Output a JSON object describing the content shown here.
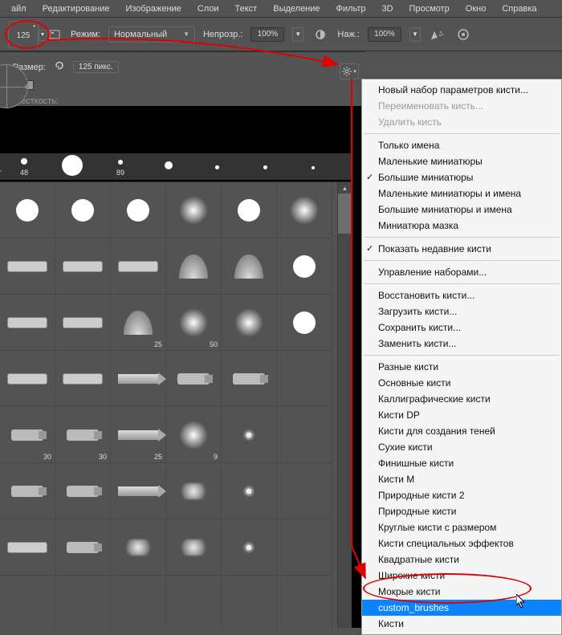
{
  "menubar": [
    "айл",
    "Редактирование",
    "Изображение",
    "Слои",
    "Текст",
    "Выделение",
    "Фильтр",
    "3D",
    "Просмотр",
    "Окно",
    "Справка"
  ],
  "options": {
    "brush_size": "125",
    "mode_label": "Режим:",
    "mode_value": "Нормальный",
    "opacity_label": "Непрозр.:",
    "opacity_value": "100%",
    "flow_label": "Наж.:",
    "flow_value": "100%"
  },
  "preset_panel": {
    "size_label": "Размер:",
    "size_value": "125 пикс.",
    "hardness_label": "Жесткость:"
  },
  "brush_strip": [
    {
      "num": "48",
      "r": 5
    },
    {
      "num": "",
      "r": 14
    },
    {
      "num": "89",
      "r": 4
    },
    {
      "num": "",
      "r": 6
    },
    {
      "num": "",
      "r": 3
    },
    {
      "num": "",
      "r": 3
    },
    {
      "num": "",
      "r": 2
    }
  ],
  "thumb_grid": {
    "row_captions": [
      "",
      "",
      "25,50",
      "",
      "30,30,25,9",
      "",
      ""
    ]
  },
  "context_menu": [
    {
      "t": "item",
      "label": "Новый набор параметров кисти..."
    },
    {
      "t": "item",
      "label": "Переименовать кисть...",
      "disabled": true
    },
    {
      "t": "item",
      "label": "Удалить кисть",
      "disabled": true
    },
    {
      "t": "sep"
    },
    {
      "t": "item",
      "label": "Только имена"
    },
    {
      "t": "item",
      "label": "Маленькие миниатюры"
    },
    {
      "t": "item",
      "label": "Большие миниатюры",
      "checked": true
    },
    {
      "t": "item",
      "label": "Маленькие миниатюры и имена"
    },
    {
      "t": "item",
      "label": "Большие миниатюры и имена"
    },
    {
      "t": "item",
      "label": "Миниатюра мазка"
    },
    {
      "t": "sep"
    },
    {
      "t": "item",
      "label": "Показать недавние кисти",
      "checked": true
    },
    {
      "t": "sep"
    },
    {
      "t": "item",
      "label": "Управление наборами..."
    },
    {
      "t": "sep"
    },
    {
      "t": "item",
      "label": "Восстановить кисти..."
    },
    {
      "t": "item",
      "label": "Загрузить кисти..."
    },
    {
      "t": "item",
      "label": "Сохранить кисти..."
    },
    {
      "t": "item",
      "label": "Заменить кисти..."
    },
    {
      "t": "sep"
    },
    {
      "t": "item",
      "label": "Разные кисти"
    },
    {
      "t": "item",
      "label": "Основные кисти"
    },
    {
      "t": "item",
      "label": "Каллиграфические кисти"
    },
    {
      "t": "item",
      "label": "Кисти DP"
    },
    {
      "t": "item",
      "label": "Кисти для создания теней"
    },
    {
      "t": "item",
      "label": "Сухие кисти"
    },
    {
      "t": "item",
      "label": "Финишные кисти"
    },
    {
      "t": "item",
      "label": "Кисти M"
    },
    {
      "t": "item",
      "label": "Природные кисти 2"
    },
    {
      "t": "item",
      "label": "Природные кисти"
    },
    {
      "t": "item",
      "label": "Круглые кисти с размером"
    },
    {
      "t": "item",
      "label": "Кисти специальных эффектов"
    },
    {
      "t": "item",
      "label": "Квадратные кисти"
    },
    {
      "t": "item",
      "label": "Широкие кисти"
    },
    {
      "t": "item",
      "label": "Мокрые кисти"
    },
    {
      "t": "item",
      "label": "custom_brushes",
      "highlighted": true
    },
    {
      "t": "item",
      "label": "Кисти"
    }
  ]
}
